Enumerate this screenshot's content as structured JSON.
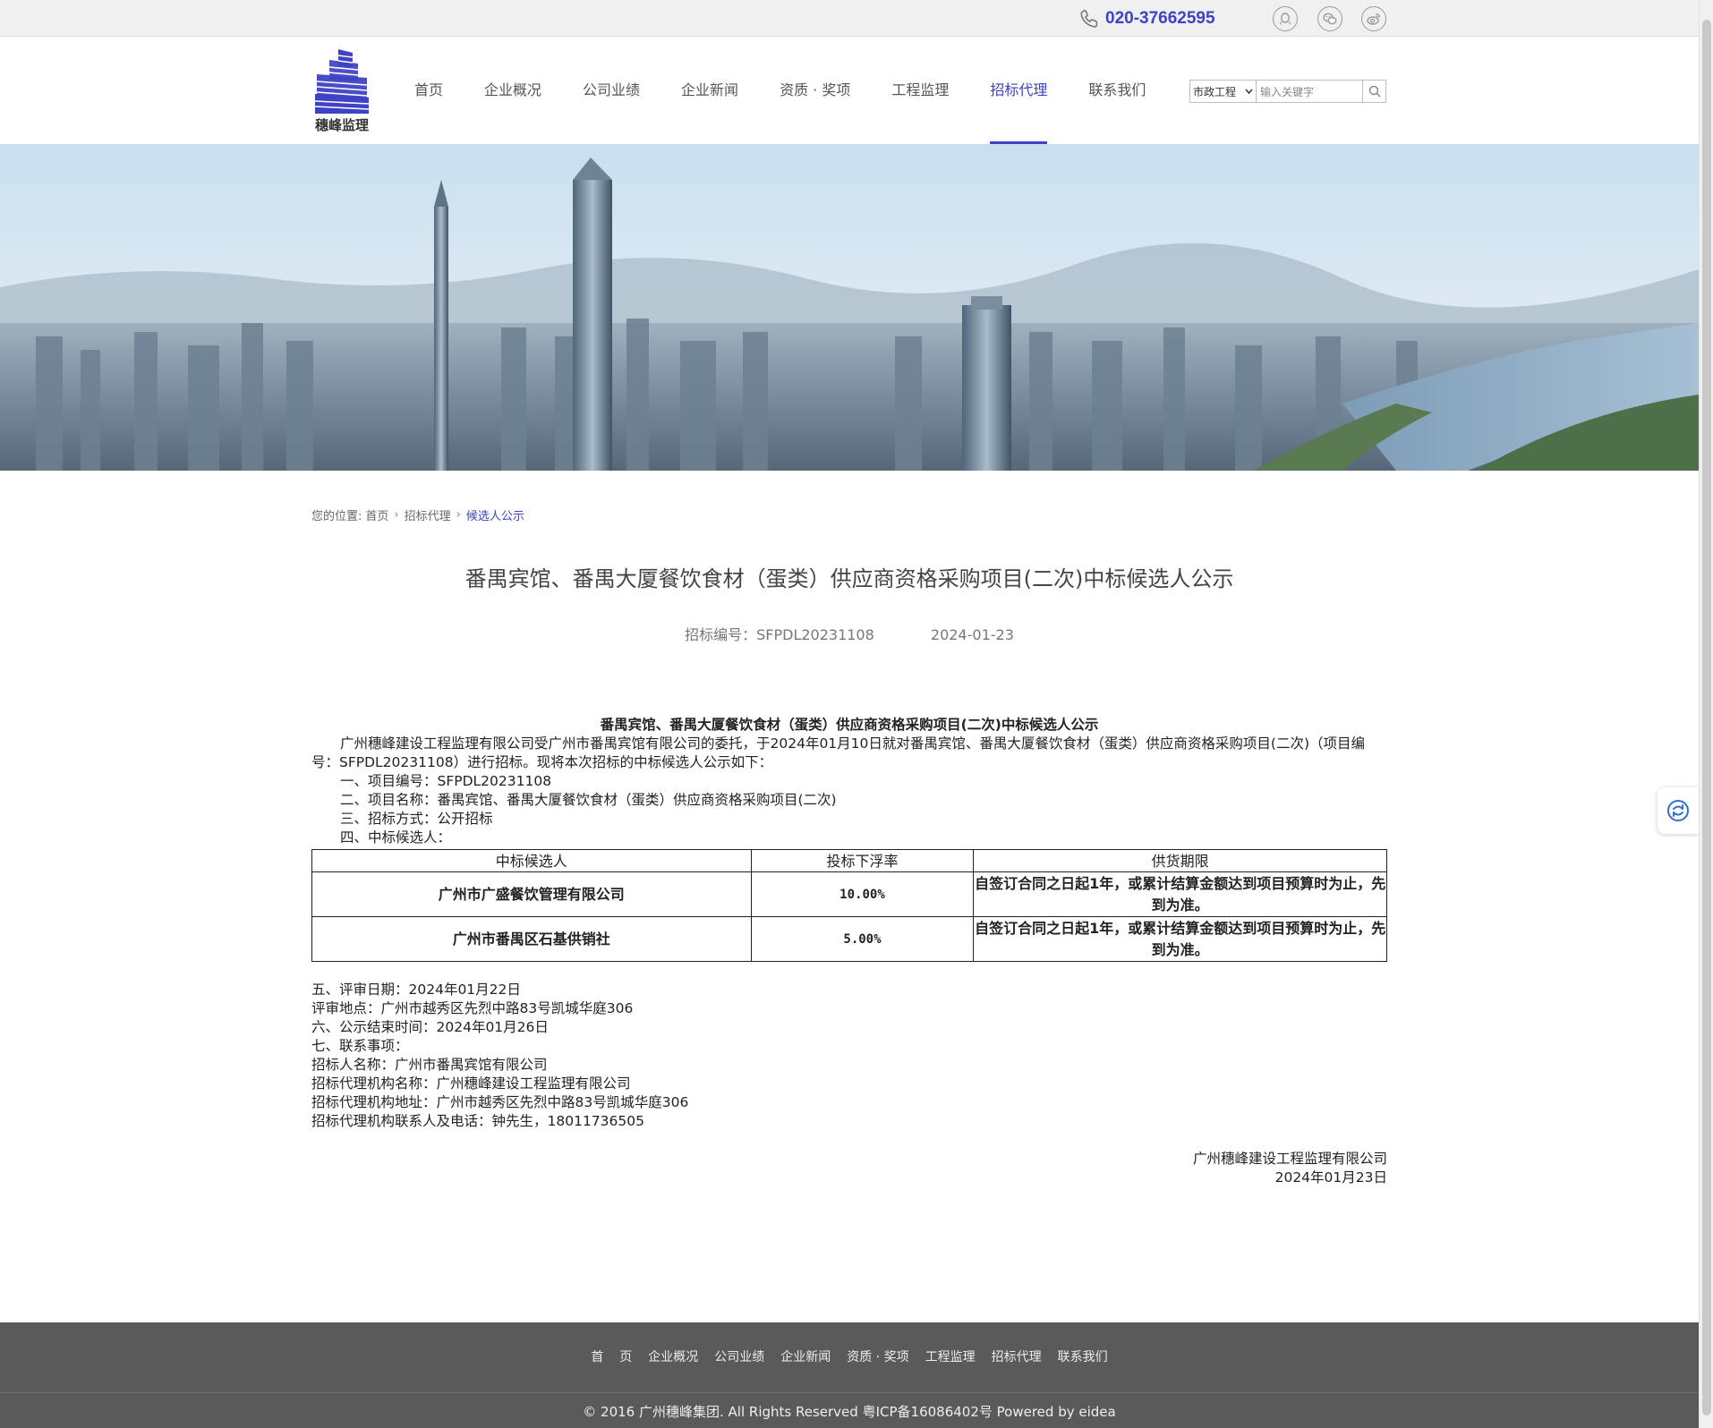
{
  "topbar": {
    "phone": "020-37662595",
    "social_icons": [
      "qq-icon",
      "wechat-icon",
      "weibo-icon"
    ]
  },
  "header": {
    "logo_text": "穗峰监理",
    "nav": [
      {
        "label": "首页",
        "active": false
      },
      {
        "label": "企业概况",
        "active": false
      },
      {
        "label": "公司业绩",
        "active": false
      },
      {
        "label": "企业新闻",
        "active": false
      },
      {
        "label": "资质 · 奖项",
        "active": false
      },
      {
        "label": "工程监理",
        "active": false
      },
      {
        "label": "招标代理",
        "active": true
      },
      {
        "label": "联系我们",
        "active": false
      }
    ],
    "search": {
      "category": "市政工程",
      "placeholder": "输入关键字"
    }
  },
  "breadcrumb": {
    "prefix": "您的位置:",
    "items": [
      "首页",
      "招标代理",
      "候选人公示"
    ]
  },
  "article": {
    "title": "番禺宾馆、番禺大厦餐饮食材（蛋类）供应商资格采购项目(二次)中标候选人公示",
    "code": "招标编号：SFPDL20231108",
    "date": "2024-01-23",
    "content_title": "番禺宾馆、番禺大厦餐饮食材（蛋类）供应商资格采购项目(二次)中标候选人公示",
    "intro": "广州穗峰建设工程监理有限公司受广州市番禺宾馆有限公司的委托，于2024年01月10日就对番禺宾馆、番禺大厦餐饮食材（蛋类）供应商资格采购项目(二次)（项目编号：SFPDL20231108）进行招标。现将本次招标的中标候选人公示如下：",
    "items": [
      "一、项目编号：SFPDL20231108",
      "二、项目名称：番禺宾馆、番禺大厦餐饮食材（蛋类）供应商资格采购项目(二次)",
      "三、招标方式：公开招标",
      "四、中标候选人："
    ],
    "table": {
      "headers": [
        "中标候选人",
        "投标下浮率",
        "供货期限"
      ],
      "rows": [
        [
          "广州市广盛餐饮管理有限公司",
          "10.00%",
          "自签订合同之日起1年，或累计结算金额达到项目预算时为止，先到为准。"
        ],
        [
          "广州市番禺区石基供销社",
          "5.00%",
          "自签订合同之日起1年，或累计结算金额达到项目预算时为止，先到为准。"
        ]
      ]
    },
    "details": [
      "五、评审日期：2024年01月22日",
      "评审地点：广州市越秀区先烈中路83号凯城华庭306",
      "六、公示结束时间：2024年01月26日",
      "七、联系事项：",
      "招标人名称：广州市番禺宾馆有限公司",
      "招标代理机构名称：广州穗峰建设工程监理有限公司",
      "招标代理机构地址：广州市越秀区先烈中路83号凯城华庭306",
      "招标代理机构联系人及电话：钟先生，18011736505"
    ],
    "signature_company": "广州穗峰建设工程监理有限公司",
    "signature_date": "2024年01月23日"
  },
  "footer": {
    "nav": [
      "首    页",
      "企业概况",
      "公司业绩",
      "企业新闻",
      "资质 · 奖项",
      "工程监理",
      "招标代理",
      "联系我们"
    ],
    "copyright": "© 2016 广州穗峰集团. All Rights Reserved",
    "icp": "粤ICP备16086402号",
    "powered": "Powered by eidea"
  },
  "colors": {
    "accent": "#3e42c4",
    "footer_bg": "#5a5a5a",
    "topbar_bg": "#f0f0f0"
  }
}
